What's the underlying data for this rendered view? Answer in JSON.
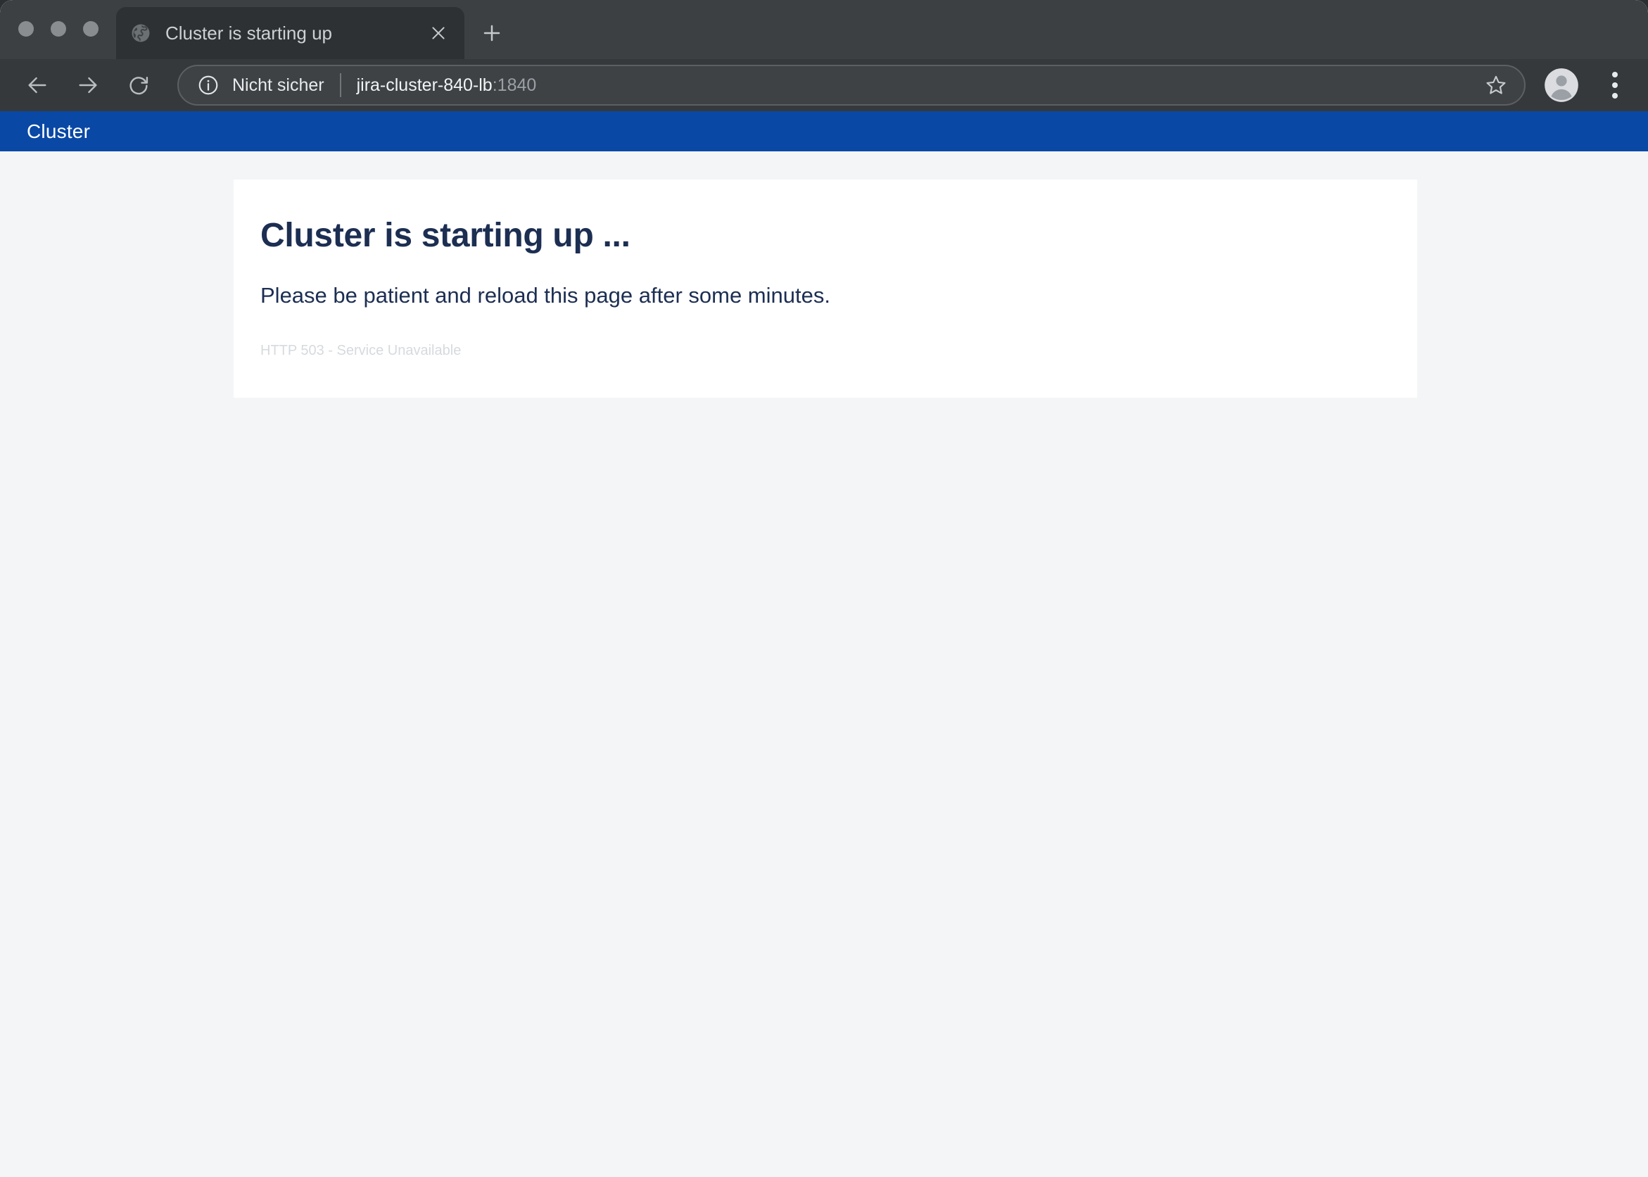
{
  "browser": {
    "window_controls": {
      "close_label": "close-window",
      "minimize_label": "minimize-window",
      "maximize_label": "maximize-window"
    },
    "tab": {
      "title": "Cluster is starting up",
      "favicon": "globe-icon",
      "close_label": "×"
    },
    "new_tab_label": "+",
    "nav": {
      "back": "back-icon",
      "forward": "forward-icon",
      "reload": "reload-icon"
    },
    "omnibox": {
      "security_icon": "info-circle-icon",
      "security_text": "Nicht sicher",
      "url_host": "jira-cluster-840-lb",
      "url_port": ":1840",
      "bookmark_icon": "star-icon"
    },
    "profile_icon": "account-avatar-icon",
    "menu_icon": "three-dot-menu-icon"
  },
  "page": {
    "appbar": {
      "brand": "Cluster",
      "background_color": "#0948A5"
    },
    "card": {
      "title": "Cluster is starting up ...",
      "body": "Please be patient and reload this page after some minutes.",
      "footnote": "HTTP 503 - Service Unavailable",
      "title_color": "#1C2E52",
      "background_color": "#FFFFFF"
    },
    "background_color": "#F4F5F7"
  }
}
